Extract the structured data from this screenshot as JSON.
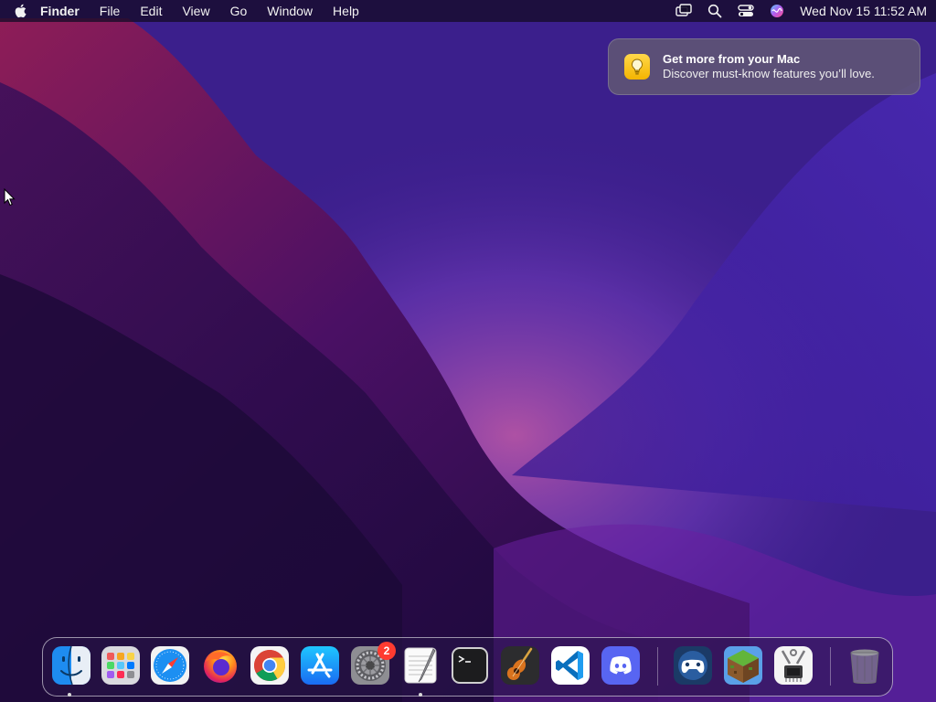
{
  "menubar": {
    "app_name": "Finder",
    "menus": [
      "File",
      "Edit",
      "View",
      "Go",
      "Window",
      "Help"
    ],
    "status_icons": [
      "screen-mirroring-icon",
      "search-icon",
      "control-center-icon",
      "siri-icon"
    ],
    "clock": "Wed Nov 15  11:52 AM"
  },
  "notification": {
    "title": "Get more from your Mac",
    "body": "Discover must-know features you’ll love.",
    "icon": "lightbulb-icon",
    "icon_color": "#f4b400"
  },
  "dock": {
    "apps": [
      {
        "id": "finder",
        "icon": "finder-icon",
        "running": true
      },
      {
        "id": "launchpad",
        "icon": "launchpad-icon",
        "running": false
      },
      {
        "id": "safari",
        "icon": "safari-icon",
        "running": false
      },
      {
        "id": "firefox",
        "icon": "firefox-icon",
        "running": false
      },
      {
        "id": "chrome",
        "icon": "chrome-icon",
        "running": false
      },
      {
        "id": "app-store",
        "icon": "app-store-icon",
        "running": false
      },
      {
        "id": "system-settings",
        "icon": "system-settings-icon",
        "running": false,
        "badge": "2"
      },
      {
        "id": "textedit",
        "icon": "textedit-icon",
        "running": true
      },
      {
        "id": "terminal",
        "icon": "terminal-icon",
        "running": false
      },
      {
        "id": "garageband",
        "icon": "garageband-icon",
        "running": false
      },
      {
        "id": "vscode",
        "icon": "vscode-icon",
        "running": false
      },
      {
        "id": "discord",
        "icon": "discord-icon",
        "running": false
      },
      {
        "id": "game-controller",
        "icon": "game-controller-icon",
        "running": false
      },
      {
        "id": "minecraft",
        "icon": "minecraft-icon",
        "running": false
      },
      {
        "id": "system-information",
        "icon": "system-information-icon",
        "running": false
      },
      {
        "id": "trash",
        "icon": "trash-icon",
        "running": false
      }
    ],
    "settings_badge": "2"
  },
  "colors": {
    "wallpaper_base": "#2a0d5a",
    "wallpaper_accent": "#c2357f",
    "menubar": "#140c28",
    "badge": "#ff3b30"
  }
}
